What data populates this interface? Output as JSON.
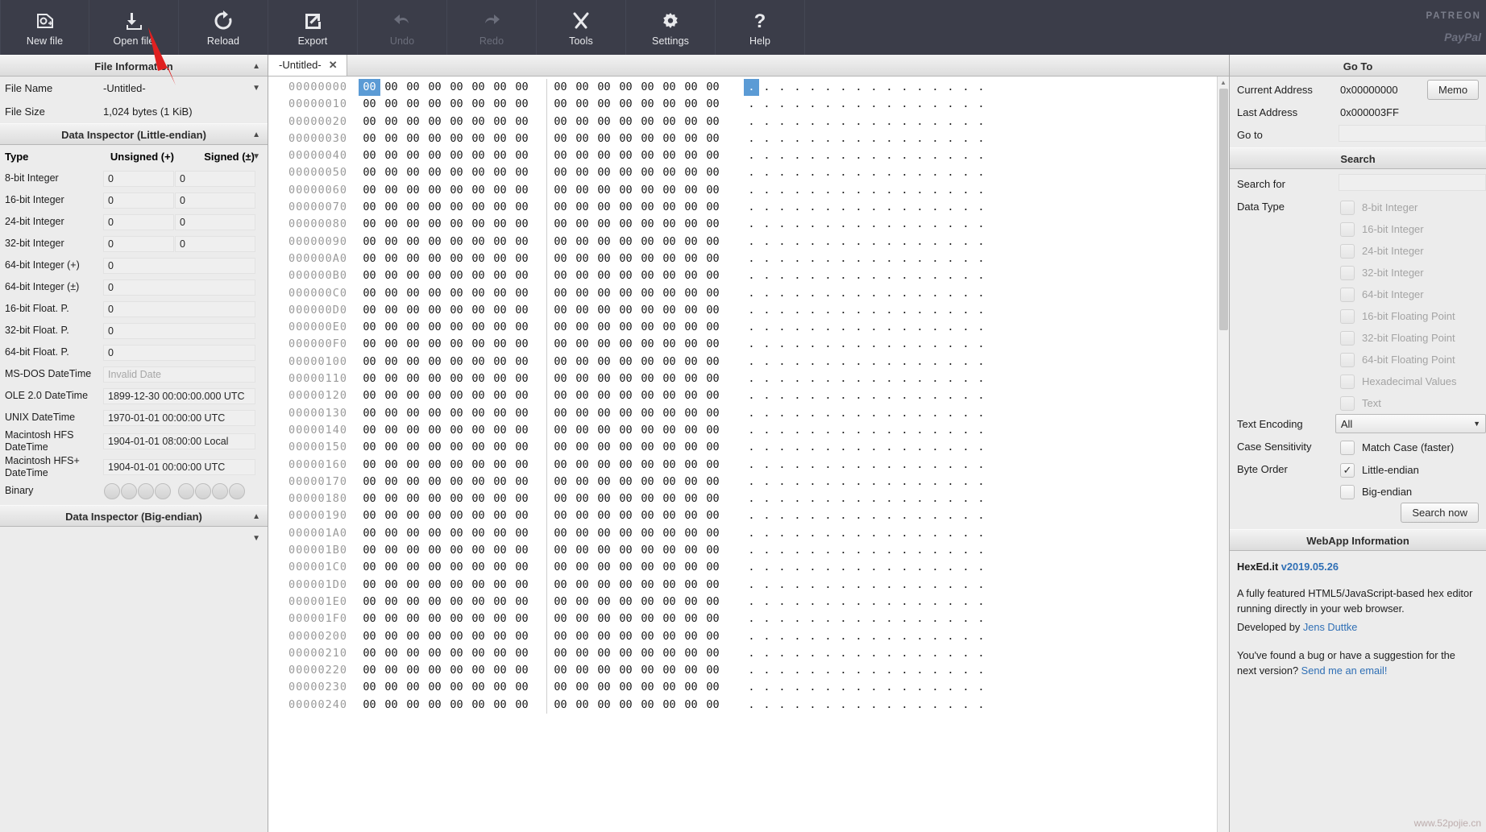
{
  "toolbar": {
    "buttons": [
      {
        "label": "New file",
        "icon": "new-file-icon",
        "disabled": false
      },
      {
        "label": "Open file",
        "icon": "open-file-icon",
        "disabled": false
      },
      {
        "label": "Reload",
        "icon": "reload-icon",
        "disabled": false
      },
      {
        "label": "Export",
        "icon": "export-icon",
        "disabled": false
      },
      {
        "label": "Undo",
        "icon": "undo-icon",
        "disabled": true
      },
      {
        "label": "Redo",
        "icon": "redo-icon",
        "disabled": true
      },
      {
        "label": "Tools",
        "icon": "tools-icon",
        "disabled": false
      },
      {
        "label": "Settings",
        "icon": "gear-icon",
        "disabled": false
      },
      {
        "label": "Help",
        "icon": "question-icon",
        "disabled": false
      }
    ],
    "patreon": "PATREON",
    "paypal": "PayPal"
  },
  "file_information": {
    "title": "File Information",
    "name_label": "File Name",
    "name_value": "-Untitled-",
    "size_label": "File Size",
    "size_value": "1,024 bytes (1 KiB)"
  },
  "inspector_le": {
    "title": "Data Inspector (Little-endian)",
    "col_type": "Type",
    "col_unsigned": "Unsigned (+)",
    "col_signed": "Signed (±)",
    "rows": [
      {
        "label": "8-bit Integer",
        "unsigned": "0",
        "signed": "0",
        "wide": false
      },
      {
        "label": "16-bit Integer",
        "unsigned": "0",
        "signed": "0",
        "wide": false
      },
      {
        "label": "24-bit Integer",
        "unsigned": "0",
        "signed": "0",
        "wide": false
      },
      {
        "label": "32-bit Integer",
        "unsigned": "0",
        "signed": "0",
        "wide": false
      },
      {
        "label": "64-bit Integer (+)",
        "unsigned": "0",
        "wide": true
      },
      {
        "label": "64-bit Integer (±)",
        "unsigned": "0",
        "wide": true
      },
      {
        "label": "16-bit Float. P.",
        "unsigned": "0",
        "wide": true
      },
      {
        "label": "32-bit Float. P.",
        "unsigned": "0",
        "wide": true
      },
      {
        "label": "64-bit Float. P.",
        "unsigned": "0",
        "wide": true
      },
      {
        "label": "MS-DOS DateTime",
        "unsigned": "Invalid Date",
        "wide": true,
        "placeholder": true
      },
      {
        "label": "OLE 2.0 DateTime",
        "unsigned": "1899-12-30 00:00:00.000 UTC",
        "wide": true
      },
      {
        "label": "UNIX DateTime",
        "unsigned": "1970-01-01 00:00:00 UTC",
        "wide": true
      },
      {
        "label": "Macintosh HFS DateTime",
        "unsigned": "1904-01-01 08:00:00 Local",
        "wide": true
      },
      {
        "label": "Macintosh HFS+ DateTime",
        "unsigned": "1904-01-01 00:00:00 UTC",
        "wide": true
      }
    ],
    "binary_label": "Binary",
    "binary_bits": 8
  },
  "inspector_be": {
    "title": "Data Inspector (Big-endian)"
  },
  "editor": {
    "tab_label": "-Untitled-",
    "tab_close": "✕",
    "bytes_per_row": 16,
    "byte_value": "00",
    "ascii_char": ".",
    "selected_index": 0,
    "offsets": [
      "00000000",
      "00000010",
      "00000020",
      "00000030",
      "00000040",
      "00000050",
      "00000060",
      "00000070",
      "00000080",
      "00000090",
      "000000A0",
      "000000B0",
      "000000C0",
      "000000D0",
      "000000E0",
      "000000F0",
      "00000100",
      "00000110",
      "00000120",
      "00000130",
      "00000140",
      "00000150",
      "00000160",
      "00000170",
      "00000180",
      "00000190",
      "000001A0",
      "000001B0",
      "000001C0",
      "000001D0",
      "000001E0",
      "000001F0",
      "00000200",
      "00000210",
      "00000220",
      "00000230",
      "00000240"
    ]
  },
  "goto": {
    "title": "Go To",
    "current_address_label": "Current Address",
    "current_address_value": "0x00000000",
    "last_address_label": "Last Address",
    "last_address_value": "0x000003FF",
    "goto_label": "Go to",
    "goto_value": "",
    "memo_button": "Memo"
  },
  "search": {
    "title": "Search",
    "search_for_label": "Search for",
    "search_for_value": "",
    "data_type_label": "Data Type",
    "data_types": [
      {
        "label": "8-bit Integer",
        "checked": false,
        "disabled": true
      },
      {
        "label": "16-bit Integer",
        "checked": false,
        "disabled": true
      },
      {
        "label": "24-bit Integer",
        "checked": false,
        "disabled": true
      },
      {
        "label": "32-bit Integer",
        "checked": false,
        "disabled": true
      },
      {
        "label": "64-bit Integer",
        "checked": false,
        "disabled": true
      },
      {
        "label": "16-bit Floating Point",
        "checked": false,
        "disabled": true
      },
      {
        "label": "32-bit Floating Point",
        "checked": false,
        "disabled": true
      },
      {
        "label": "64-bit Floating Point",
        "checked": false,
        "disabled": true
      },
      {
        "label": "Hexadecimal Values",
        "checked": false,
        "disabled": true
      },
      {
        "label": "Text",
        "checked": false,
        "disabled": true
      }
    ],
    "text_encoding_label": "Text Encoding",
    "text_encoding_value": "All",
    "case_sensitivity_label": "Case Sensitivity",
    "match_case_label": "Match Case (faster)",
    "match_case_checked": false,
    "byte_order_label": "Byte Order",
    "byte_orders": [
      {
        "label": "Little-endian",
        "checked": true
      },
      {
        "label": "Big-endian",
        "checked": false
      }
    ],
    "search_now_button": "Search now"
  },
  "webapp": {
    "title": "WebApp Information",
    "brand": "HexEd.it",
    "version": "v2019.05.26",
    "description": "A fully featured HTML5/JavaScript-based hex editor running directly in your web browser.",
    "developed_by_prefix": "Developed by ",
    "developer": "Jens Duttke",
    "bug_text_1": "You've found a bug or have a suggestion for the next version? ",
    "bug_link": "Send me an email!"
  },
  "watermark": "www.52pojie.cn",
  "colors": {
    "toolbar_bg": "#3b3d49",
    "panel_bg": "#ececec",
    "selection": "#5b9bd5",
    "link": "#2f6fb5",
    "pointer": "#e02020"
  }
}
